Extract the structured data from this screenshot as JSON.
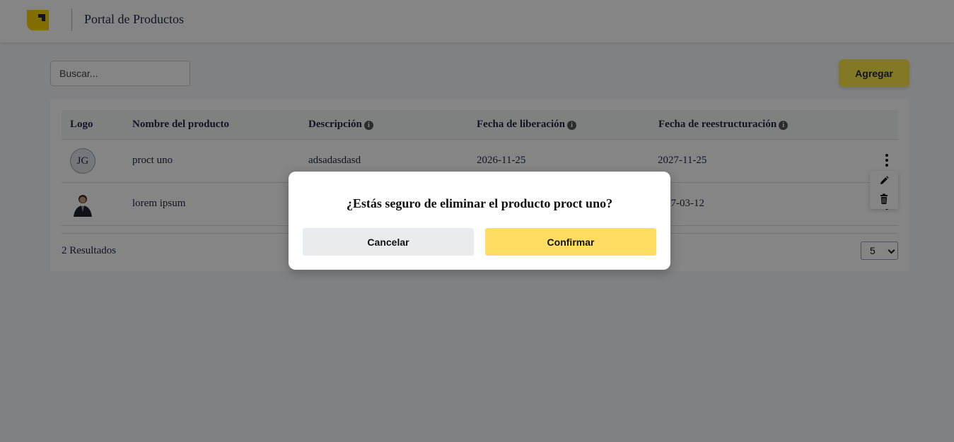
{
  "header": {
    "title": "Portal de Productos",
    "brand_color": "#f7d100"
  },
  "toolbar": {
    "search_placeholder": "Buscar...",
    "add_label": "Agregar",
    "add_color": "#fce64a"
  },
  "table": {
    "columns": [
      {
        "label": "Logo",
        "info_icon": false
      },
      {
        "label": "Nombre del producto",
        "info_icon": false
      },
      {
        "label": "Descripción",
        "info_icon": true
      },
      {
        "label": "Fecha de liberación",
        "info_icon": true
      },
      {
        "label": "Fecha de reestructuración",
        "info_icon": true
      }
    ],
    "rows": [
      {
        "logo_initials": "JG",
        "name": "proct uno",
        "description": "adsadasdasd",
        "release_date": "2026-11-25",
        "restructure_date": "2027-11-25"
      },
      {
        "logo_initials": "",
        "logo_icon": "person-photo",
        "name": "lorem ipsum",
        "description": "",
        "release_date": "",
        "restructure_date": "27-03-12"
      }
    ],
    "row_menu": {
      "items": [
        {
          "icon": "pencil-icon"
        },
        {
          "icon": "trash-icon"
        }
      ]
    }
  },
  "footer": {
    "results_text": "2 Resultados",
    "page_size": "5"
  },
  "modal": {
    "title": "¿Estás seguro de eliminar el producto proct uno?",
    "cancel_label": "Cancelar",
    "confirm_label": "Confirmar",
    "confirm_color": "#ffdd63"
  }
}
